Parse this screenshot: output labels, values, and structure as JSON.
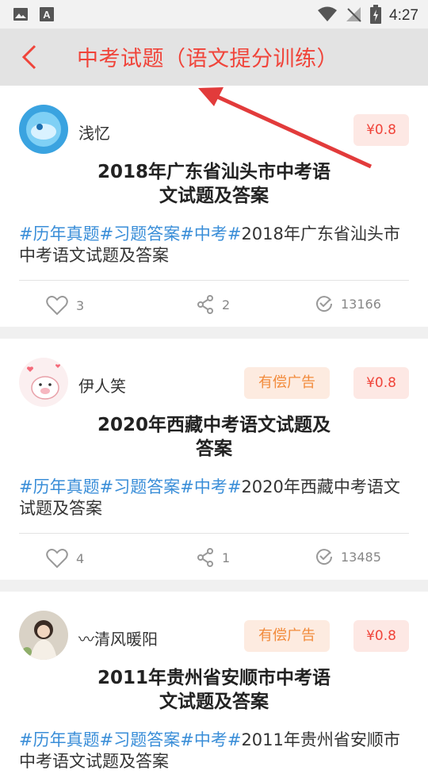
{
  "status_bar": {
    "time": "4:27"
  },
  "header": {
    "title": "中考试题（语文提分训练）"
  },
  "posts": [
    {
      "username": "浅忆",
      "price": "¥0.8",
      "ad_label": "",
      "title": "2018年广东省汕头市中考语文试题及答案",
      "title_line1": "2018年广东省汕头市中考语",
      "title_line2": "文试题及答案",
      "tags": [
        "#历年真题",
        "#习题答案",
        "#中考",
        "#"
      ],
      "desc": "2018年广东省汕头市中考语文试题及答案",
      "likes": "3",
      "shares": "2",
      "views": "13166"
    },
    {
      "username": "伊人笑",
      "price": "¥0.8",
      "ad_label": "有偿广告",
      "title_line1": "2020年西藏中考语文试题及",
      "title_line2": "答案",
      "tags": [
        "#历年真题",
        "#习题答案",
        "#中考",
        "#"
      ],
      "desc": "2020年西藏中考语文试题及答案",
      "likes": "4",
      "shares": "1",
      "views": "13485"
    },
    {
      "username": "〰清风暖阳",
      "price": "¥0.8",
      "ad_label": "有偿广告",
      "title_line1": "2011年贵州省安顺市中考语",
      "title_line2": "文试题及答案",
      "tags": [
        "#历年真题",
        "#习题答案",
        "#中考",
        "#"
      ],
      "desc": "2011年贵州省安顺市中考语文试题及答案",
      "likes": "",
      "shares": "",
      "views": ""
    }
  ],
  "colors": {
    "accent": "#f0443a",
    "tag": "#3a8ed8",
    "ad_text": "#f28b3c"
  }
}
